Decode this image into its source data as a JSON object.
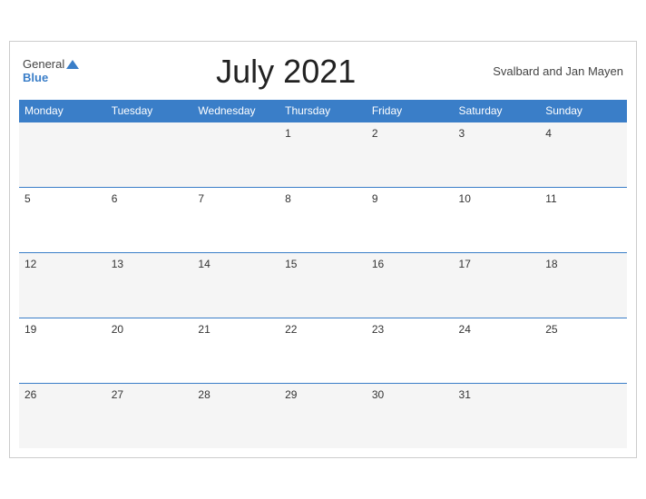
{
  "header": {
    "title": "July 2021",
    "region": "Svalbard and Jan Mayen",
    "logo_general": "General",
    "logo_blue": "Blue"
  },
  "weekdays": [
    "Monday",
    "Tuesday",
    "Wednesday",
    "Thursday",
    "Friday",
    "Saturday",
    "Sunday"
  ],
  "weeks": [
    [
      null,
      null,
      null,
      1,
      2,
      3,
      4
    ],
    [
      5,
      6,
      7,
      8,
      9,
      10,
      11
    ],
    [
      12,
      13,
      14,
      15,
      16,
      17,
      18
    ],
    [
      19,
      20,
      21,
      22,
      23,
      24,
      25
    ],
    [
      26,
      27,
      28,
      29,
      30,
      31,
      null
    ]
  ]
}
